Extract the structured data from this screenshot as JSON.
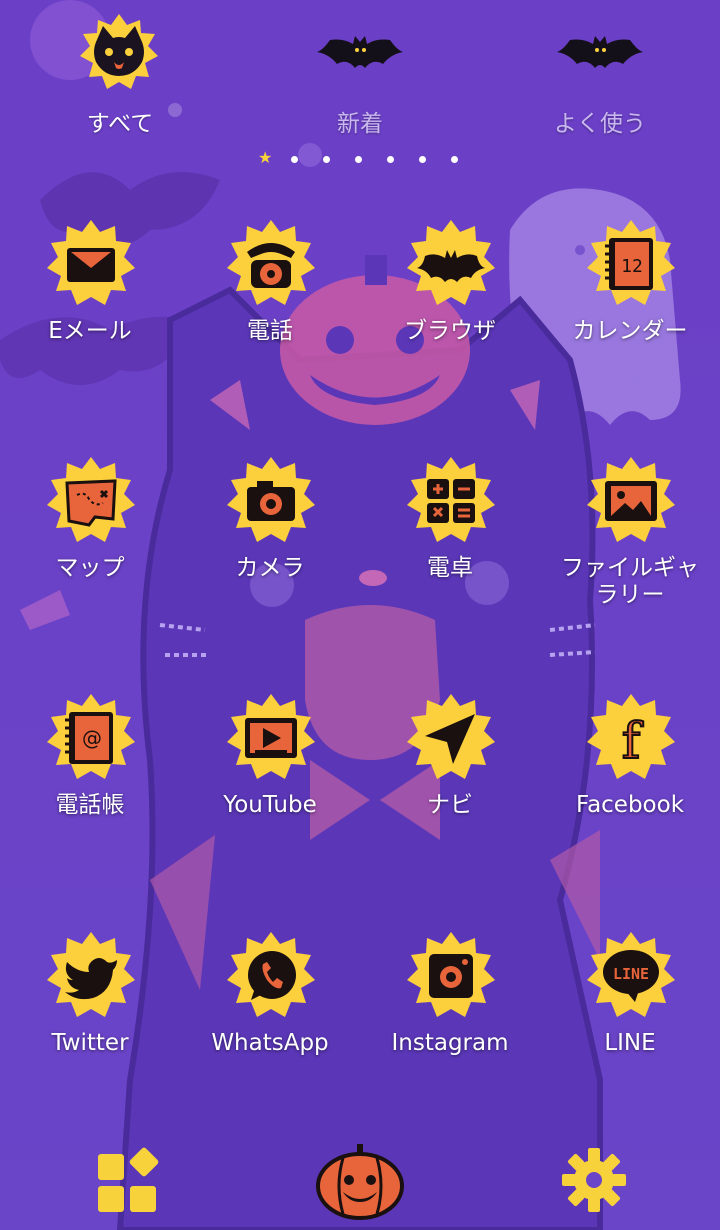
{
  "tabs": [
    {
      "label": "すべて",
      "active": true,
      "icon": "black-cat-icon"
    },
    {
      "label": "新着",
      "active": false,
      "icon": "bat-icon"
    },
    {
      "label": "よく使う",
      "active": false,
      "icon": "bat-icon"
    }
  ],
  "page_indicator": {
    "pages": 7,
    "current": 1
  },
  "apps": [
    {
      "label": "Eメール",
      "icon": "envelope-icon"
    },
    {
      "label": "電話",
      "icon": "rotary-phone-icon"
    },
    {
      "label": "ブラウザ",
      "icon": "bat-icon"
    },
    {
      "label": "カレンダー",
      "icon": "calendar-icon"
    },
    {
      "label": "マップ",
      "icon": "treasure-map-icon"
    },
    {
      "label": "カメラ",
      "icon": "camera-icon"
    },
    {
      "label": "電卓",
      "icon": "calculator-icon"
    },
    {
      "label": "ファイルギャラリー",
      "icon": "gallery-picture-icon"
    },
    {
      "label": "電話帳",
      "icon": "address-book-icon"
    },
    {
      "label": "YouTube",
      "icon": "video-play-icon"
    },
    {
      "label": "ナビ",
      "icon": "navigation-arrow-icon"
    },
    {
      "label": "Facebook",
      "icon": "facebook-f-icon"
    },
    {
      "label": "Twitter",
      "icon": "twitter-bird-icon"
    },
    {
      "label": "WhatsApp",
      "icon": "whatsapp-phone-icon"
    },
    {
      "label": "Instagram",
      "icon": "instagram-camera-icon"
    },
    {
      "label": "LINE",
      "icon": "line-bubble-icon"
    }
  ],
  "calendar_number": "12",
  "line_badge_text": "LINE",
  "facebook_letter": "f",
  "dock": [
    {
      "name": "apps-grid",
      "icon": "grid-icon"
    },
    {
      "name": "home-pumpkin",
      "icon": "pumpkin-icon"
    },
    {
      "name": "settings",
      "icon": "gear-icon"
    }
  ],
  "colors": {
    "background": "#6a3fc4",
    "badge_yellow": "#fcd03c",
    "icon_orange": "#e8643a",
    "icon_black": "#1a1010"
  }
}
